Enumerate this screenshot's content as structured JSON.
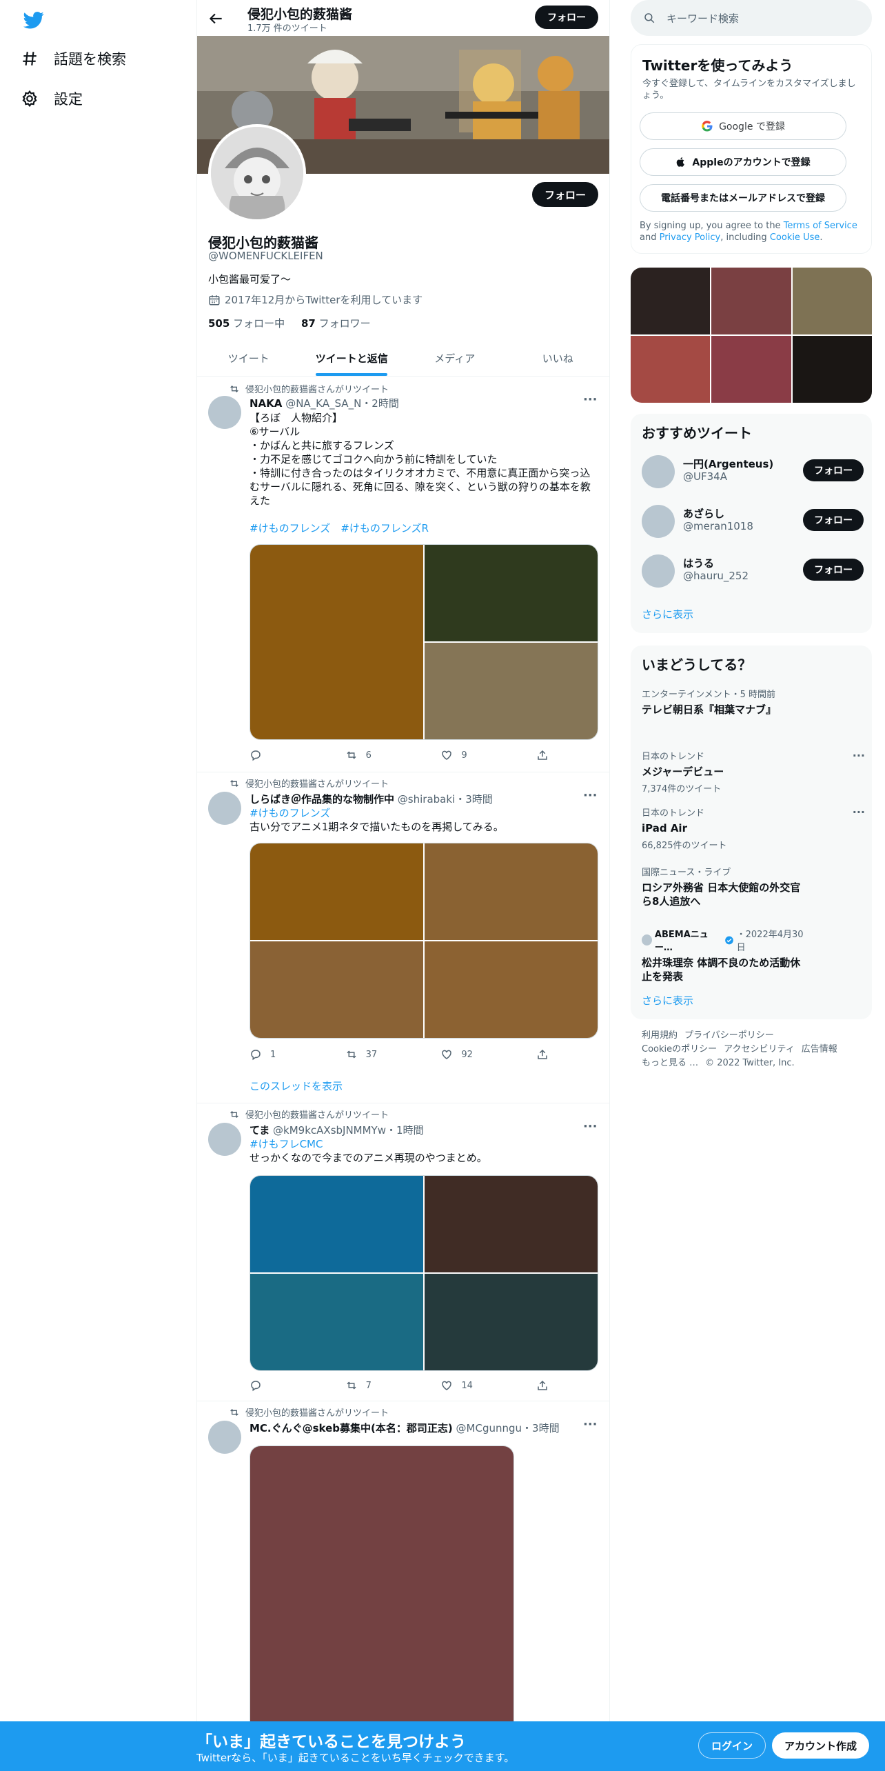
{
  "nav": {
    "explore": "話題を検索",
    "settings": "設定"
  },
  "header": {
    "name": "侵犯小包的薮猫酱",
    "tweet_count": "1.7万 件のツイート",
    "follow": "フォロー"
  },
  "profile": {
    "name": "侵犯小包的薮猫酱",
    "handle": "@WOMENFUCKLEIFEN",
    "bio": "小包酱最可爱了～",
    "joined": "2017年12月からTwitterを利用しています",
    "following_count": "505",
    "following_label": "フォロー中",
    "followers_count": "87",
    "followers_label": "フォロワー",
    "follow": "フォロー"
  },
  "tabs": [
    "ツイート",
    "ツイートと返信",
    "メディア",
    "いいね"
  ],
  "tweets": [
    {
      "retweeted_by": "侵犯小包的薮猫酱さんがリツイート",
      "name": "NAKA",
      "handle": "@NA_KA_SA_N",
      "time": "・2時間",
      "text": "【ろぼ　人物紹介】\n⑥サーバル\n・かばんと共に旅するフレンズ\n・力不足を感じてゴコクへ向かう前に特訓をしていた\n・特訓に付き合ったのはタイリクオオカミで、不用意に真正面から突っ込むサーバルに隠れる、死角に回る、隙を突く、という獣の狩りの基本を教えた",
      "hashtags": "#けものフレンズ　#けものフレンズR",
      "replies": "",
      "retweets": "6",
      "likes": "9",
      "media_colors": [
        "#8c5a10",
        "#2f3a1e",
        "#857556"
      ]
    },
    {
      "retweeted_by": "侵犯小包的薮猫酱さんがリツイート",
      "name": "しらばき＠作品集的な物制作中",
      "handle": "@shirabaki",
      "time": "・3時間",
      "hashtag": "#けものフレンズ",
      "text": "古い分でアニメ1期ネタで描いたものを再掲してみる。",
      "replies": "1",
      "retweets": "37",
      "likes": "92",
      "media_colors": [
        "#8c5a10",
        "#8a6232",
        "#8a6235",
        "#8c6232"
      ],
      "thread": "このスレッドを表示"
    },
    {
      "retweeted_by": "侵犯小包的薮猫酱さんがリツイート",
      "name": "てま",
      "handle": "@kM9kcAXsbJNMMYw",
      "time": "・1時間",
      "hashtag": "#けもフレCMC",
      "text": "せっかくなので今までのアニメ再現のやつまとめ。",
      "replies": "",
      "retweets": "7",
      "likes": "14",
      "media_colors": [
        "#0e6a9a",
        "#402c25",
        "#1a6b84",
        "#253a3c"
      ]
    },
    {
      "retweeted_by": "侵犯小包的薮猫酱さんがリツイート",
      "name": "MC.ぐんぐ@skeb募集中(本名：郡司正志)",
      "handle": "@MCgunngu",
      "time": "・3時間",
      "media_colors": [
        "#734142"
      ]
    }
  ],
  "right": {
    "search_placeholder": "キーワード検索",
    "signup_title": "Twitterを使ってみよう",
    "signup_sub": "今すぐ登録して、タイムラインをカスタマイズしましょう。",
    "google": "Google で登録",
    "apple": "Appleのアカウントで登録",
    "phone": "電話番号またはメールアドレスで登録",
    "terms_pre": "By signing up, you agree to the ",
    "terms_tos": "Terms of Service",
    "terms_and": " and ",
    "terms_privacy": "Privacy Policy",
    "terms_mid": ", including ",
    "terms_cookie": "Cookie Use",
    "terms_end": ".",
    "photo_colors": [
      "#2b2220",
      "#7a4042",
      "#7e7254",
      "#a44a44",
      "#8a3c46",
      "#1a1614"
    ],
    "rec_title": "おすすめツイート",
    "recs": [
      {
        "name": "一円(Argenteus)",
        "handle": "@UF34A",
        "btn": "フォロー"
      },
      {
        "name": "あざらし",
        "handle": "@meran1018",
        "btn": "フォロー"
      },
      {
        "name": "はうる",
        "handle": "@hauru_252",
        "btn": "フォロー"
      }
    ],
    "rec_more": "さらに表示",
    "trends_title": "いまどうしてる？",
    "trends": [
      {
        "cat": "エンターテインメント・5 時間前",
        "title": "テレビ朝日系『相葉マナブ』",
        "count": ""
      },
      {
        "cat": "日本のトレンド",
        "title": "メジャーデビュー",
        "count": "7,374件のツイート"
      },
      {
        "cat": "日本のトレンド",
        "title": "iPad Air",
        "count": "66,825件のツイート"
      },
      {
        "cat": "国際ニュース・ライブ",
        "title": "ロシア外務省 日本大使館の外交官ら8人追放へ",
        "count": ""
      },
      {
        "cat": "ABEMAニュー…",
        "date": "・2022年4月30日",
        "title": "松井珠理奈 体調不良のため活動休止を発表",
        "count": ""
      }
    ],
    "trends_more": "さらに表示",
    "footer": [
      "利用規約",
      "プライバシーポリシー",
      "Cookieのポリシー",
      "アクセシビリティ",
      "広告情報",
      "もっと見る …",
      "© 2022 Twitter, Inc."
    ]
  },
  "bottom": {
    "title": "「いま」起きていることを見つけよう",
    "sub": "Twitterなら、「いま」起きていることをいち早くチェックできます。",
    "login": "ログイン",
    "signup": "アカウント作成"
  }
}
